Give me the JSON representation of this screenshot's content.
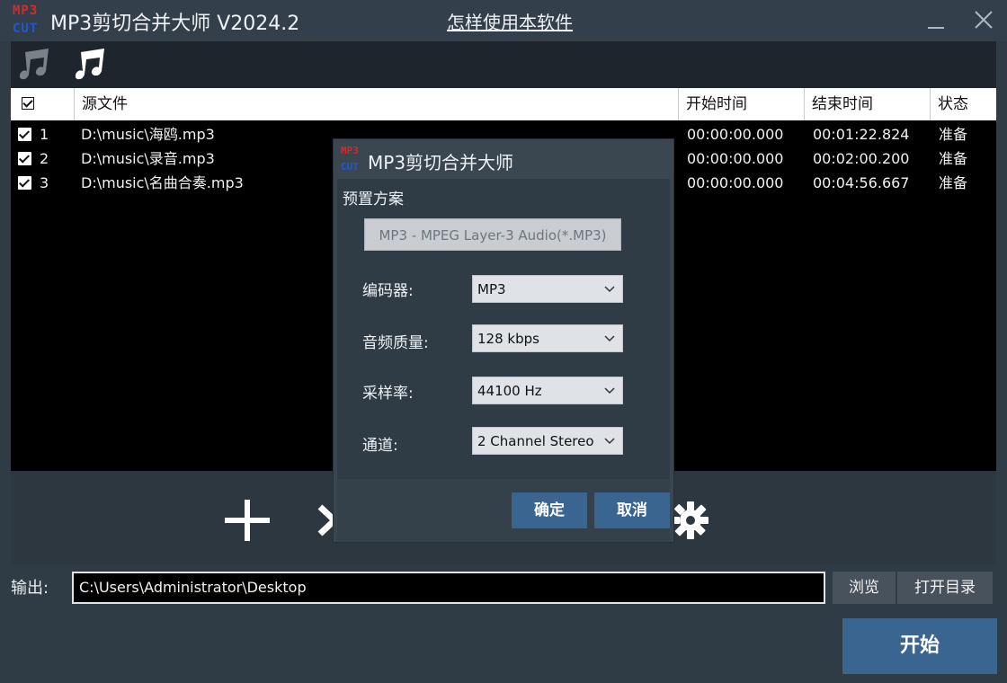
{
  "app": {
    "logo_top": "MP3",
    "logo_bottom": "CUT",
    "title": "MP3剪切合并大师 V2024.2",
    "help_link": "怎样使用本软件"
  },
  "table": {
    "headers": {
      "source": "源文件",
      "start": "开始时间",
      "end": "结束时间",
      "status": "状态"
    },
    "rows": [
      {
        "index": "1",
        "file": "D:\\music\\海鸥.mp3",
        "start": "00:00:00.000",
        "end": "00:01:22.824",
        "status": "准备"
      },
      {
        "index": "2",
        "file": "D:\\music\\录音.mp3",
        "start": "00:00:00.000",
        "end": "00:02:00.200",
        "status": "准备"
      },
      {
        "index": "3",
        "file": "D:\\music\\名曲合奏.mp3",
        "start": "00:00:00.000",
        "end": "00:04:56.667",
        "status": "准备"
      }
    ]
  },
  "output": {
    "label": "输出:",
    "path": "C:\\Users\\Administrator\\Desktop",
    "browse": "浏览",
    "open_dir": "打开目录",
    "start": "开始"
  },
  "dialog": {
    "logo_top": "MP3",
    "logo_bottom": "CUT",
    "title": "MP3剪切合并大师",
    "preset_label": "预置方案",
    "preset_value": "MP3 - MPEG Layer-3 Audio(*.MP3)",
    "encoder_label": "编码器:",
    "encoder_value": "MP3",
    "quality_label": "音频质量:",
    "quality_value": "128 kbps",
    "samplerate_label": "采样率:",
    "samplerate_value": "44100 Hz",
    "channel_label": "通道:",
    "channel_value": "2 Channel Stereo",
    "ok": "确定",
    "cancel": "取消"
  },
  "icons": {
    "music_dim": "music-note-icon",
    "music": "music-note-icon",
    "add": "plus-icon",
    "cut": "chevron-icon",
    "settings": "gear-icon",
    "minimize": "minimize-icon",
    "close": "close-icon"
  },
  "colors": {
    "accent": "#3a6591",
    "background": "#2f3b45",
    "list_background": "#000000"
  }
}
